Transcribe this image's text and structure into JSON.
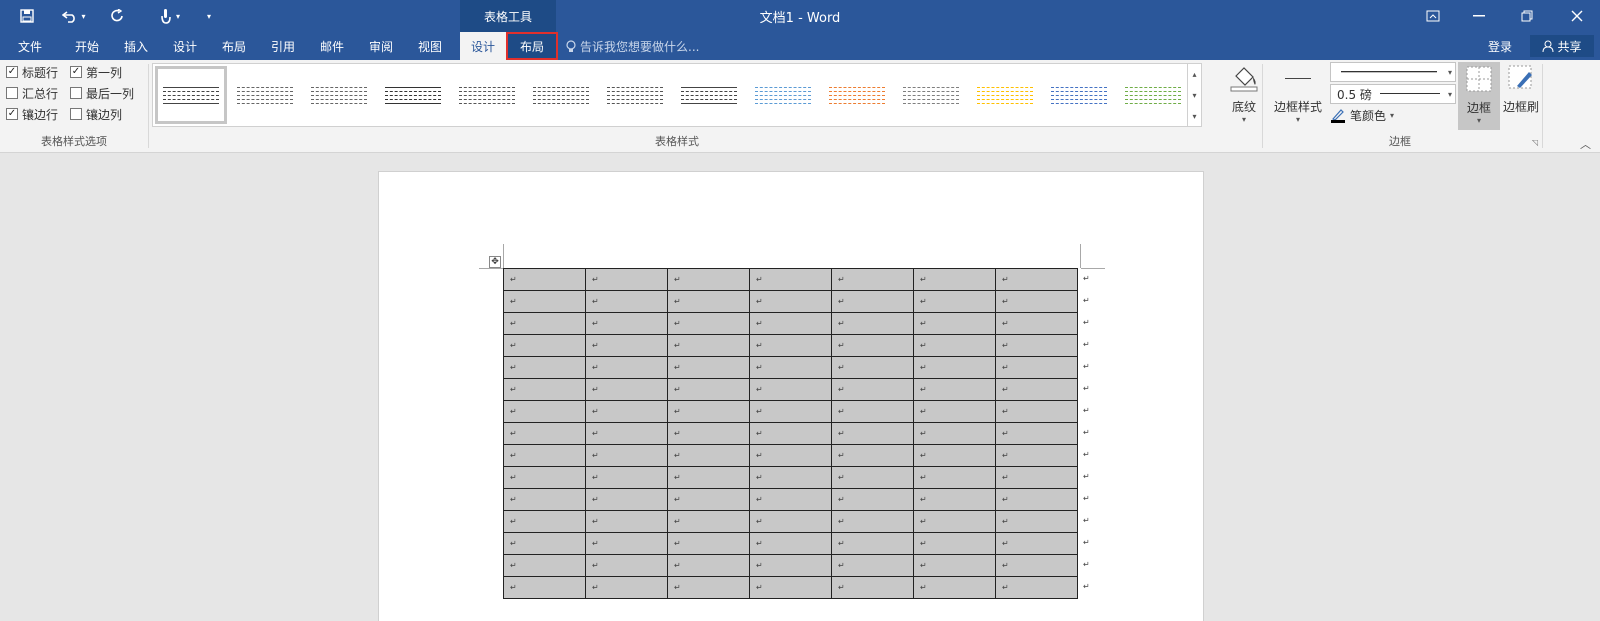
{
  "titlebar": {
    "context_group": "表格工具",
    "window_title": "文档1 - Word"
  },
  "tabs": [
    {
      "label": "文件"
    },
    {
      "label": "开始"
    },
    {
      "label": "插入"
    },
    {
      "label": "设计"
    },
    {
      "label": "布局"
    },
    {
      "label": "引用"
    },
    {
      "label": "邮件"
    },
    {
      "label": "审阅"
    },
    {
      "label": "视图"
    },
    {
      "label": "设计"
    },
    {
      "label": "布局"
    }
  ],
  "tellme": {
    "placeholder": "告诉我您想要做什么..."
  },
  "account": {
    "login": "登录",
    "share": "共享"
  },
  "style_options": {
    "group_label": "表格样式选项",
    "items": [
      {
        "label": "标题行",
        "checked": true
      },
      {
        "label": "第一列",
        "checked": true
      },
      {
        "label": "汇总行",
        "checked": false
      },
      {
        "label": "最后一列",
        "checked": false
      },
      {
        "label": "镶边行",
        "checked": true
      },
      {
        "label": "镶边列",
        "checked": false
      }
    ]
  },
  "table_styles": {
    "group_label": "表格样式",
    "accent_colors": [
      "#444444",
      "#666666",
      "#666666",
      "#333333",
      "#555555",
      "#555555",
      "#555555",
      "#444444",
      "#5b9bd5",
      "#ed7d31",
      "#7f7f7f",
      "#ffc000",
      "#4472c4",
      "#70ad47"
    ]
  },
  "shading": {
    "label": "底纹"
  },
  "borders": {
    "group_label": "边框",
    "border_styles_label": "边框样式",
    "line_weight": "0.5 磅",
    "pen_color_label": "笔颜色",
    "borders_label": "边框",
    "border_painter_label": "边框刷"
  },
  "document": {
    "table_rows": 15,
    "table_cols": 7,
    "cell_mark": "↵"
  }
}
